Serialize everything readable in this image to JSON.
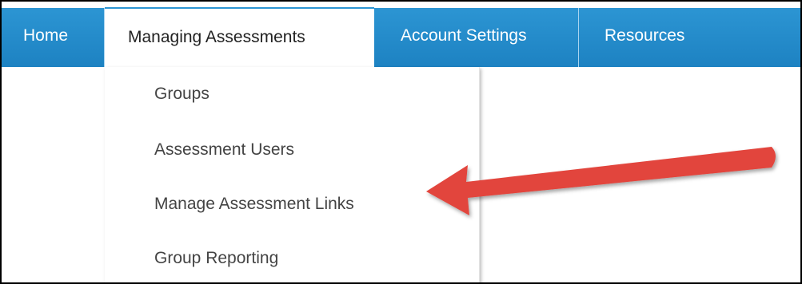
{
  "nav": {
    "items": [
      {
        "label": "Home"
      },
      {
        "label": "Managing Assessments"
      },
      {
        "label": "Account Settings"
      },
      {
        "label": "Resources"
      }
    ]
  },
  "dropdown": {
    "items": [
      {
        "label": "Groups"
      },
      {
        "label": "Assessment Users"
      },
      {
        "label": "Manage Assessment Links"
      },
      {
        "label": "Group Reporting"
      }
    ]
  },
  "colors": {
    "nav_blue": "#1d82c2",
    "arrow_red": "#e2453c",
    "menu_text": "#444444"
  },
  "annotation": {
    "icon": "red-arrow-pointer",
    "target": "Manage Assessment Links"
  }
}
